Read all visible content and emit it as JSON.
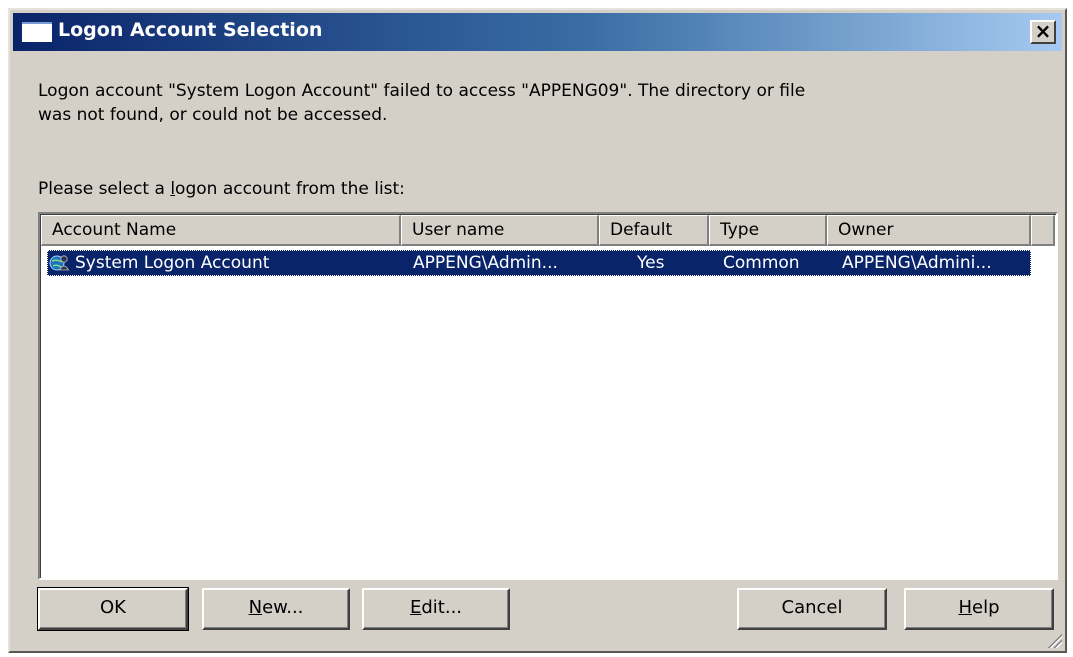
{
  "window": {
    "title": "Logon Account Selection",
    "close_glyph": "×"
  },
  "message": {
    "line1": "Logon account \"System Logon Account\" failed to access \"APPENG09\".  The directory or file",
    "line2": "was not found, or could not be accessed."
  },
  "prompt": {
    "before": "Please select a ",
    "accel": "l",
    "after": "ogon account from the list:"
  },
  "list": {
    "columns": [
      "Account Name",
      "User name",
      "Default",
      "Type",
      "Owner"
    ],
    "rows": [
      {
        "icon": "user-globe-icon",
        "account_name": "System Logon Account",
        "user_name": "APPENG\\Admin...",
        "default": "Yes",
        "type": "Common",
        "owner": "APPENG\\Admini...",
        "selected": true
      }
    ]
  },
  "buttons": {
    "ok": {
      "label": "OK"
    },
    "new": {
      "accel": "N",
      "rest": "ew..."
    },
    "edit": {
      "accel": "E",
      "rest": "dit..."
    },
    "cancel": {
      "label": "Cancel"
    },
    "help": {
      "accel": "H",
      "rest": "elp"
    }
  },
  "colors": {
    "title_active": "#0a246a",
    "title_gradient_end": "#a6caf0",
    "face": "#d4d0c8",
    "selection": "#0a246a"
  }
}
